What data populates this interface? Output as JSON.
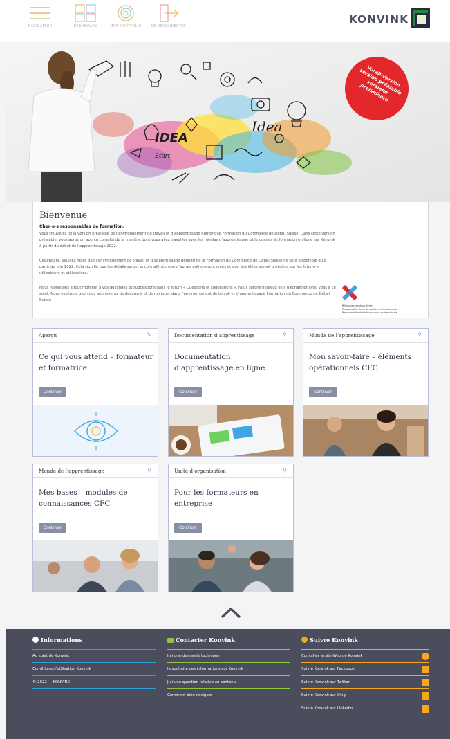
{
  "nav": {
    "items": [
      {
        "label": "NAVIGATEUR",
        "icon": "hamburger-icon"
      },
      {
        "label": "DASHBOARD",
        "icon": "dashboard-icon"
      },
      {
        "label": "MON PORTFOLIO",
        "icon": "portfolio-icon"
      },
      {
        "label": "SE DÉCONNECTER",
        "icon": "logout-icon"
      }
    ],
    "brand": "KONVINK"
  },
  "hero": {
    "badge": "Vorab-Version\nversion préalable\nversione\npreliminare",
    "scroll_icon": "chevron-down-icon"
  },
  "welcome": {
    "title": "Bienvenue",
    "greeting": "Cher·e·s responsables de formation,",
    "p1": "Vous trouverez ici la version préalable de l’environnement de travail et d’apprentissage numérique Formation du Commerce de Détail Suisse. Dans cette version préalable, vous aurez un aperçu complet de la manière dont vous allez travailler avec les médias d’apprentissage et le dossier de formation en ligne sur Konvink à partir du début de l’apprentissage 2022.",
    "p2": "Cependant, veuillez noter que l’environnement de travail et d’apprentissage définitif de la Formation du Commerce de Détail Suisse ne sera disponible qu’à partir de juin 2022. Cela signifie que les détails seront encore affinés, que d’autres outils seront créés et que des idées seront projetées sur les futur·e·s utilisateurs et utilisatrices.",
    "p3": "Nous répondons à tout moment à vos questions et suggestions dans le forum « Questions et suggestions ». Nous serons heureux·se·s d’échanger avec vous à ce sujet. Nous espérons que vous apprécierez de découvrir et de naviguer dans l’environnement de travail et d’apprentissage Formation du Commerce de Détail Suisse !",
    "partner": "Bildungsverantwortliche\nResponsable de la formation professionnelle\nResponsabile della formazione professionale"
  },
  "cards": [
    {
      "category": "Aperçu",
      "title": "Ce qui vous attend – formateur et formatrice",
      "button": "Continuer",
      "image": "eye-illustration"
    },
    {
      "category": "Documentation d’apprentissage",
      "title": "Documentation d’apprentissage en ligne",
      "button": "Continuer",
      "image": "desk-laptop-photo"
    },
    {
      "category": "Monde de l’apprentissage",
      "title": "Mon savoir-faire – éléments opérationnels CFC",
      "button": "Continuer",
      "image": "cafe-staff-photo"
    },
    {
      "category": "Monde de l’apprentissage",
      "title": "Mes bases – modules de connaissances CFC",
      "button": "Continuer",
      "image": "office-team-photo"
    },
    {
      "category": "Unité d’organisation",
      "title": "Pour les formateurs en entreprise",
      "button": "Continuer",
      "image": "high-five-photo"
    }
  ],
  "footer": {
    "columns": [
      {
        "heading": "Informations",
        "icon": "info-icon",
        "color": "#29a3d9",
        "links": [
          "Au sujet de Konvink",
          "Conditions d’utilisation Konvink",
          "© 2022 — KONVINK"
        ]
      },
      {
        "heading": "Contacter Konvink",
        "icon": "mail-icon",
        "color": "#8fc43c",
        "links": [
          "J’ai une demande technique",
          "Je souhaite des informations sur Konvink",
          "J’ai une question relative au contenu",
          "Comment bien naviguer"
        ]
      },
      {
        "heading": "Suivre Konvink",
        "icon": "globe-icon",
        "color": "#f4a81d",
        "links": [
          "Consulter le site Web de Konvink",
          "Suivre Konvink sur Facebook",
          "Suivre Konvink sur Twitter",
          "Suivre Konvink sur Xing",
          "Suivre Konvink sur LinkedIn"
        ],
        "link_icons": [
          "website-icon",
          "facebook-icon",
          "twitter-icon",
          "xing-icon",
          "linkedin-icon"
        ]
      }
    ]
  }
}
